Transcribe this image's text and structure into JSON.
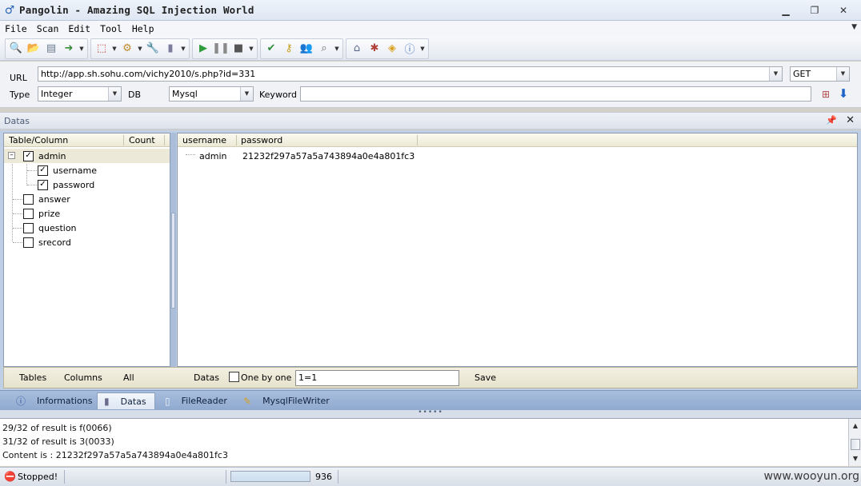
{
  "window": {
    "title": "Pangolin - Amazing SQL Injection World",
    "controls": {
      "minimize": "▭",
      "restore": "❐",
      "close": "✕"
    }
  },
  "menu": [
    "File",
    "Scan",
    "Edit",
    "Tool",
    "Help"
  ],
  "toolbar": {
    "icons": [
      "magnifier-icon",
      "open-icon",
      "save-icon",
      "export-icon",
      "filter-icon",
      "settings-icon",
      "wrench-icon",
      "database-icon",
      "play-icon",
      "pause-icon",
      "stop-icon",
      "check-icon",
      "key-icon",
      "users-icon",
      "search-icon",
      "home-icon",
      "bug-icon",
      "package-icon",
      "info-icon"
    ]
  },
  "query": {
    "url_label": "URL",
    "url_value": "http://app.sh.sohu.com/vichy2010/s.php?id=331",
    "method_value": "GET",
    "type_label": "Type",
    "type_value": "Integer",
    "db_label": "DB",
    "db_value": "Mysql",
    "keyword_label": "Keyword",
    "keyword_value": ""
  },
  "datas_panel": {
    "title": "Datas",
    "tree_headers": {
      "table_column": "Table/Column",
      "count": "Count"
    },
    "tree": [
      {
        "label": "admin",
        "checked": true,
        "level": 0,
        "expanded": true
      },
      {
        "label": "username",
        "checked": true,
        "level": 1
      },
      {
        "label": "password",
        "checked": true,
        "level": 1
      },
      {
        "label": "answer",
        "checked": false,
        "level": 0
      },
      {
        "label": "prize",
        "checked": false,
        "level": 0
      },
      {
        "label": "question",
        "checked": false,
        "level": 0
      },
      {
        "label": "srecord",
        "checked": false,
        "level": 0
      }
    ],
    "grid_headers": {
      "username": "username",
      "password": "password"
    },
    "grid_rows": [
      {
        "username": "admin",
        "password": "21232f297a57a5a743894a0e4a801fc3"
      }
    ],
    "bottom": {
      "tables": "Tables",
      "columns": "Columns",
      "all": "All",
      "datas": "Datas",
      "one_by_one": "One by one",
      "condition": "1=1",
      "save": "Save"
    }
  },
  "tabs": [
    {
      "label": "Informations",
      "icon": "info-icon",
      "active": false
    },
    {
      "label": "Datas",
      "icon": "database-icon",
      "active": true
    },
    {
      "label": "FileReader",
      "icon": "file-icon",
      "active": false
    },
    {
      "label": "MysqlFileWriter",
      "icon": "pen-icon",
      "active": false
    }
  ],
  "log": [
    "29/32 of result is f(0066)",
    "31/32 of result is 3(0033)",
    "Content is : 21232f297a57a5a743894a0e4a801fc3"
  ],
  "status": {
    "text": "Stopped!",
    "progress": 1.0,
    "count": "936",
    "watermark": "www.wooyun.org"
  },
  "colors": {
    "accent": "#2a66b8",
    "panel_bg": "#bfd0e6",
    "progress": "#4c9be0"
  }
}
